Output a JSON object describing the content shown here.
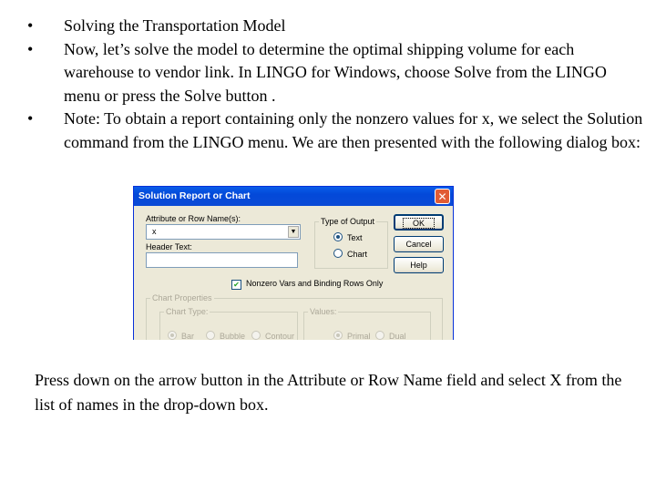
{
  "slide": {
    "bullets": [
      {
        "marker": "•",
        "text": "Solving the Transportation Model"
      },
      {
        "marker": "•",
        "text": "Now, let’s solve the model to determine the optimal shipping volume for each warehouse to vendor link. In LINGO for Windows, choose Solve from the LINGO menu or press the Solve button ."
      },
      {
        "marker": "•",
        "text": "Note: To obtain a report containing only the nonzero values for x, we select the Solution command from the LINGO menu. We are then presented with the following dialog box:"
      }
    ],
    "caption": "Press down on the arrow button in the Attribute or Row Name field and select X from the list of names in the drop-down box."
  },
  "dialog": {
    "title": "Solution Report or Chart",
    "close_icon": "close-icon",
    "attribute_label": "Attribute or Row Name(s):",
    "attribute_value": "x",
    "header_label": "Header Text:",
    "header_value": "",
    "output_group": {
      "label": "Type of Output",
      "options": [
        {
          "label": "Text",
          "selected": true
        },
        {
          "label": "Chart",
          "selected": false
        }
      ]
    },
    "buttons": {
      "ok": "OK",
      "cancel": "Cancel",
      "help": "Help"
    },
    "nonzero_checkbox": {
      "label": "Nonzero Vars and Binding Rows Only",
      "checked": true
    },
    "chart_properties": {
      "label": "Chart Properties",
      "enabled": false,
      "chart_type": {
        "label": "Chart Type:",
        "options": [
          {
            "label": "Bar",
            "selected": true
          },
          {
            "label": "Bubble",
            "selected": false
          },
          {
            "label": "Contour",
            "selected": false
          }
        ]
      },
      "values": {
        "label": "Values:",
        "options": [
          {
            "label": "Primal",
            "selected": true
          },
          {
            "label": "Dual",
            "selected": false
          }
        ]
      }
    }
  },
  "colors": {
    "title_bar": "#0a5ce8",
    "dialog_bg": "#ece9d8",
    "close_button": "#e15c35"
  }
}
